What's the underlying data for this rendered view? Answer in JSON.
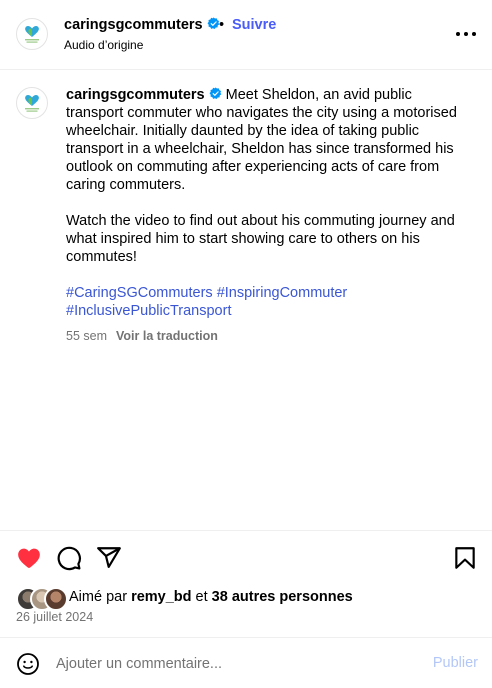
{
  "header": {
    "username": "caringsgcommuters",
    "separator": "•",
    "follow_label": "Suivre",
    "audio_label": "Audio d’origine",
    "more_icon": "more-horizontal-icon"
  },
  "caption": {
    "username": "caringsgcommuters",
    "paragraph_1": "Meet Sheldon, an avid public transport commuter who navigates the city using a motorised wheelchair. Initially daunted by the idea of taking public transport in a wheelchair, Sheldon has since transformed his outlook on commuting after experiencing acts of care from caring commuters.",
    "paragraph_2": "Watch the video to find out about his commuting journey and what inspired him to start showing care to others on his commutes!",
    "hashtags": [
      "#CaringSGCommuters",
      "#InspiringCommuter",
      "#InclusivePublicTransport"
    ],
    "time_ago": "55 sem",
    "translate_label": "Voir la traduction"
  },
  "actions": {
    "like_icon": "heart-filled-icon",
    "comment_icon": "comment-bubble-icon",
    "share_icon": "paper-plane-icon",
    "save_icon": "bookmark-icon"
  },
  "likes": {
    "prefix": "Aimé par ",
    "user": "remy_bd",
    "middle": " et ",
    "others": "38 autres personnes"
  },
  "post_date": "26 juillet 2024",
  "comment_box": {
    "placeholder": "Ajouter un commentaire...",
    "publish_label": "Publier",
    "emoji_icon": "smiley-icon"
  },
  "colors": {
    "accent": "#4a5df9",
    "hashtag": "#3a56d4",
    "like_red": "#ff3040",
    "muted": "#737373",
    "publish_disabled": "#b3c7f7"
  }
}
